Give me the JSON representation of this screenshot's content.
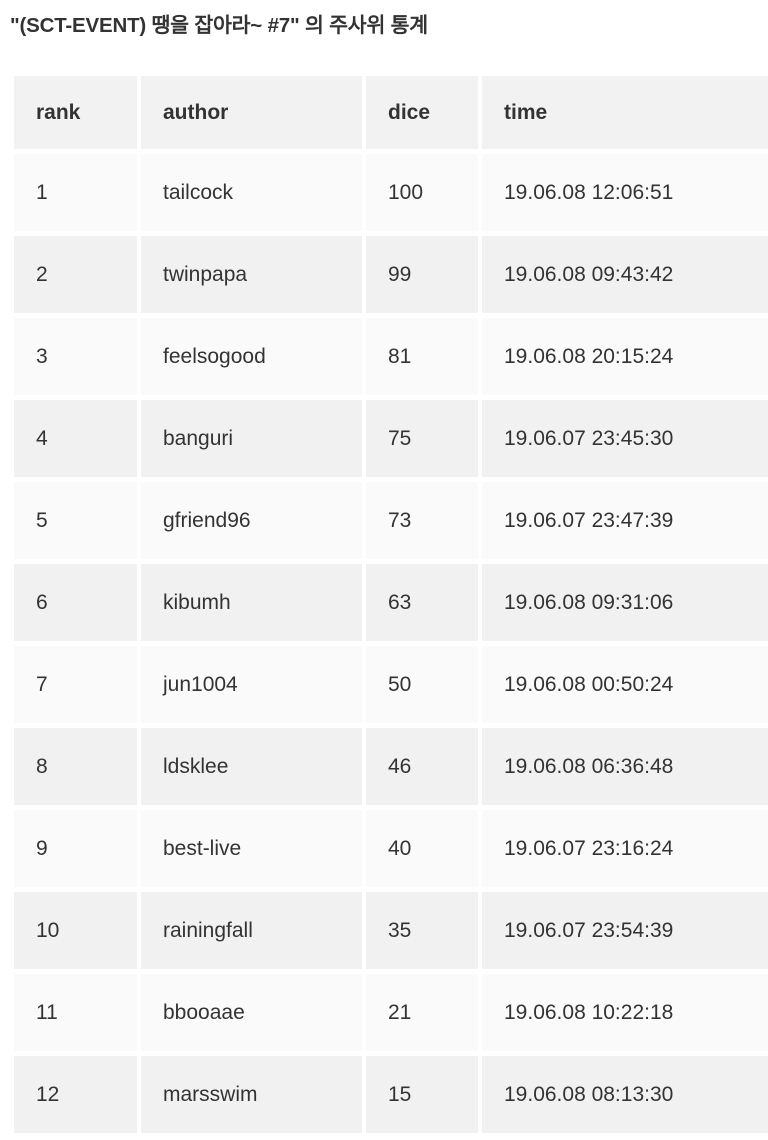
{
  "page": {
    "title": "\"(SCT-EVENT) 땡을 잡아라~ #7\" 의 주사위 통계",
    "background_color": "#ffffff",
    "text_color": "#333333"
  },
  "table": {
    "name": "dice-statistics-table",
    "header_background": "#f2f2f2",
    "row_odd_background": "#fafafa",
    "row_even_background": "#f1f1f1",
    "columns": [
      {
        "key": "rank",
        "label": "rank"
      },
      {
        "key": "author",
        "label": "author"
      },
      {
        "key": "dice",
        "label": "dice"
      },
      {
        "key": "time",
        "label": "time"
      }
    ],
    "rows": [
      {
        "rank": "1",
        "author": "tailcock",
        "dice": "100",
        "time": "19.06.08 12:06:51"
      },
      {
        "rank": "2",
        "author": "twinpapa",
        "dice": "99",
        "time": "19.06.08 09:43:42"
      },
      {
        "rank": "3",
        "author": "feelsogood",
        "dice": "81",
        "time": "19.06.08 20:15:24"
      },
      {
        "rank": "4",
        "author": "banguri",
        "dice": "75",
        "time": "19.06.07 23:45:30"
      },
      {
        "rank": "5",
        "author": "gfriend96",
        "dice": "73",
        "time": "19.06.07 23:47:39"
      },
      {
        "rank": "6",
        "author": "kibumh",
        "dice": "63",
        "time": "19.06.08 09:31:06"
      },
      {
        "rank": "7",
        "author": "jun1004",
        "dice": "50",
        "time": "19.06.08 00:50:24"
      },
      {
        "rank": "8",
        "author": "ldsklee",
        "dice": "46",
        "time": "19.06.08 06:36:48"
      },
      {
        "rank": "9",
        "author": "best-live",
        "dice": "40",
        "time": "19.06.07 23:16:24"
      },
      {
        "rank": "10",
        "author": "rainingfall",
        "dice": "35",
        "time": "19.06.07 23:54:39"
      },
      {
        "rank": "11",
        "author": "bbooaae",
        "dice": "21",
        "time": "19.06.08 10:22:18"
      },
      {
        "rank": "12",
        "author": "marsswim",
        "dice": "15",
        "time": "19.06.08 08:13:30"
      }
    ]
  },
  "chart_data": {
    "type": "table",
    "title": "\"(SCT-EVENT) 땡을 잡아라~ #7\" 의 주사위 통계",
    "columns": [
      "rank",
      "author",
      "dice",
      "time"
    ],
    "rows": [
      [
        "1",
        "tailcock",
        "100",
        "19.06.08 12:06:51"
      ],
      [
        "2",
        "twinpapa",
        "99",
        "19.06.08 09:43:42"
      ],
      [
        "3",
        "feelsogood",
        "81",
        "19.06.08 20:15:24"
      ],
      [
        "4",
        "banguri",
        "75",
        "19.06.07 23:45:30"
      ],
      [
        "5",
        "gfriend96",
        "73",
        "19.06.07 23:47:39"
      ],
      [
        "6",
        "kibumh",
        "63",
        "19.06.08 09:31:06"
      ],
      [
        "7",
        "jun1004",
        "50",
        "19.06.08 00:50:24"
      ],
      [
        "8",
        "ldsklee",
        "46",
        "19.06.08 06:36:48"
      ],
      [
        "9",
        "best-live",
        "40",
        "19.06.07 23:16:24"
      ],
      [
        "10",
        "rainingfall",
        "35",
        "19.06.07 23:54:39"
      ],
      [
        "11",
        "bbooaae",
        "21",
        "19.06.08 10:22:18"
      ],
      [
        "12",
        "marsswim",
        "15",
        "19.06.08 08:13:30"
      ]
    ],
    "categories": [
      "tailcock",
      "twinpapa",
      "feelsogood",
      "banguri",
      "gfriend96",
      "kibumh",
      "jun1004",
      "ldsklee",
      "best-live",
      "rainingfall",
      "bbooaae",
      "marsswim"
    ],
    "values": [
      100,
      99,
      81,
      75,
      73,
      63,
      50,
      46,
      40,
      35,
      21,
      15
    ],
    "xlabel": "author",
    "ylabel": "dice"
  }
}
